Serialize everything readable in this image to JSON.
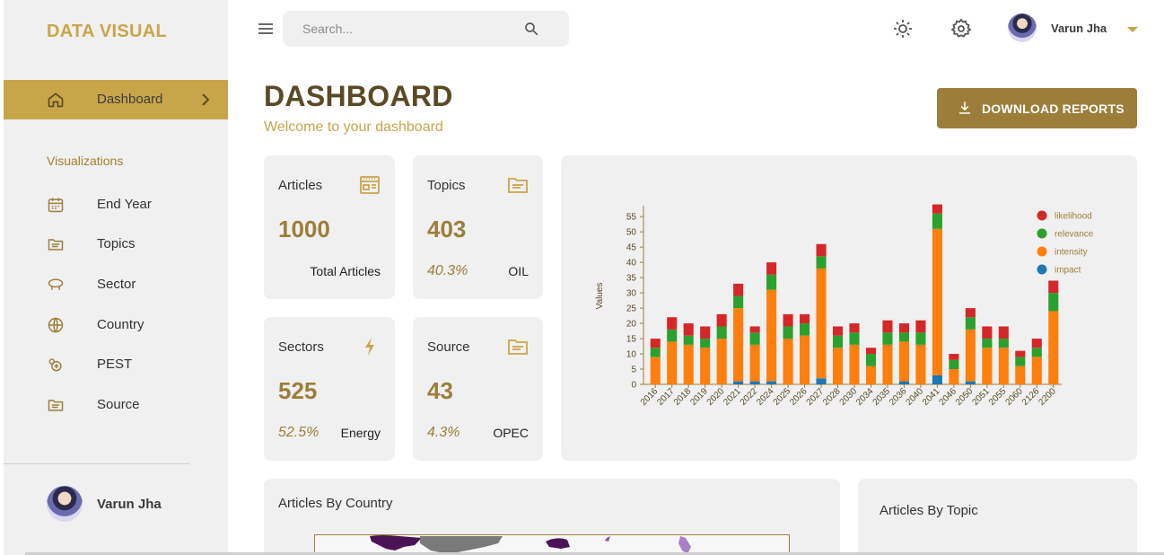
{
  "brand": "DATA VISUAL",
  "sidebar": {
    "active": {
      "label": "Dashboard",
      "icon": "home-icon"
    },
    "section_title": "Visualizations",
    "items": [
      {
        "label": "End Year",
        "icon": "calendar-icon"
      },
      {
        "label": "Topics",
        "icon": "folder-icon"
      },
      {
        "label": "Sector",
        "icon": "sector-icon"
      },
      {
        "label": "Country",
        "icon": "globe-icon"
      },
      {
        "label": "PEST",
        "icon": "pest-icon"
      },
      {
        "label": "Source",
        "icon": "folder-icon"
      }
    ],
    "user_name": "Varun Jha"
  },
  "topbar": {
    "search_placeholder": "Search...",
    "user_name": "Varun Jha"
  },
  "header": {
    "title": "DASHBOARD",
    "subtitle": "Welcome to your dashboard",
    "download_label": "DOWNLOAD REPORTS"
  },
  "cards": [
    {
      "title": "Articles",
      "value": "1000",
      "percent": "",
      "note": "Total Articles",
      "icon": "newspaper-icon"
    },
    {
      "title": "Topics",
      "value": "403",
      "percent": "40.3%",
      "note": "OIL",
      "icon": "folder-icon"
    },
    {
      "title": "Sectors",
      "value": "525",
      "percent": "52.5%",
      "note": "Energy",
      "icon": "lightning-icon"
    },
    {
      "title": "Source",
      "value": "43",
      "percent": "4.3%",
      "note": "OPEC",
      "icon": "folder-icon"
    }
  ],
  "panels": {
    "country_title": "Articles By Country",
    "topic_title": "Articles By Topic"
  },
  "colors": {
    "gold": "#c9a54a",
    "dark_gold": "#9c7e3a",
    "likelihood": "#d62728",
    "relevance": "#2ca02c",
    "intensity": "#ff7f0e",
    "impact": "#1f77b4"
  },
  "chart_data": {
    "type": "bar",
    "stacked": true,
    "ylabel": "Values",
    "xlabel": "",
    "ylim": [
      0,
      58
    ],
    "yticks": [
      0,
      5,
      10,
      15,
      20,
      25,
      30,
      35,
      40,
      45,
      50,
      55
    ],
    "legend_position": "top-right",
    "categories": [
      "2016",
      "2017",
      "2018",
      "2019",
      "2020",
      "2021",
      "2022",
      "2024",
      "2025",
      "2026",
      "2027",
      "2028",
      "2030",
      "2034",
      "2035",
      "2036",
      "2040",
      "2041",
      "2046",
      "2050",
      "2051",
      "2055",
      "2060",
      "2126",
      "2200"
    ],
    "series": [
      {
        "name": "impact",
        "color": "#1f77b4",
        "values": [
          0,
          0,
          0,
          0,
          0,
          1,
          1,
          1,
          0,
          0,
          2,
          0,
          0,
          0,
          0,
          1,
          0,
          3,
          0,
          1,
          0,
          0,
          0,
          0,
          0
        ]
      },
      {
        "name": "intensity",
        "color": "#ff7f0e",
        "values": [
          9,
          14,
          13,
          12,
          15,
          24,
          12,
          30,
          15,
          16,
          36,
          12,
          13,
          6,
          13,
          13,
          13,
          48,
          5,
          17,
          12,
          12,
          6,
          9,
          24
        ]
      },
      {
        "name": "relevance",
        "color": "#2ca02c",
        "values": [
          3,
          4,
          3,
          3,
          4,
          4,
          4,
          5,
          4,
          4,
          4,
          4,
          4,
          4,
          4,
          3,
          4,
          5,
          3,
          4,
          3,
          3,
          3,
          3,
          6
        ]
      },
      {
        "name": "likelihood",
        "color": "#d62728",
        "values": [
          3,
          4,
          4,
          4,
          4,
          4,
          2,
          4,
          4,
          3,
          4,
          3,
          3,
          2,
          4,
          3,
          4,
          3,
          2,
          3,
          4,
          4,
          2,
          3,
          4
        ]
      }
    ]
  }
}
